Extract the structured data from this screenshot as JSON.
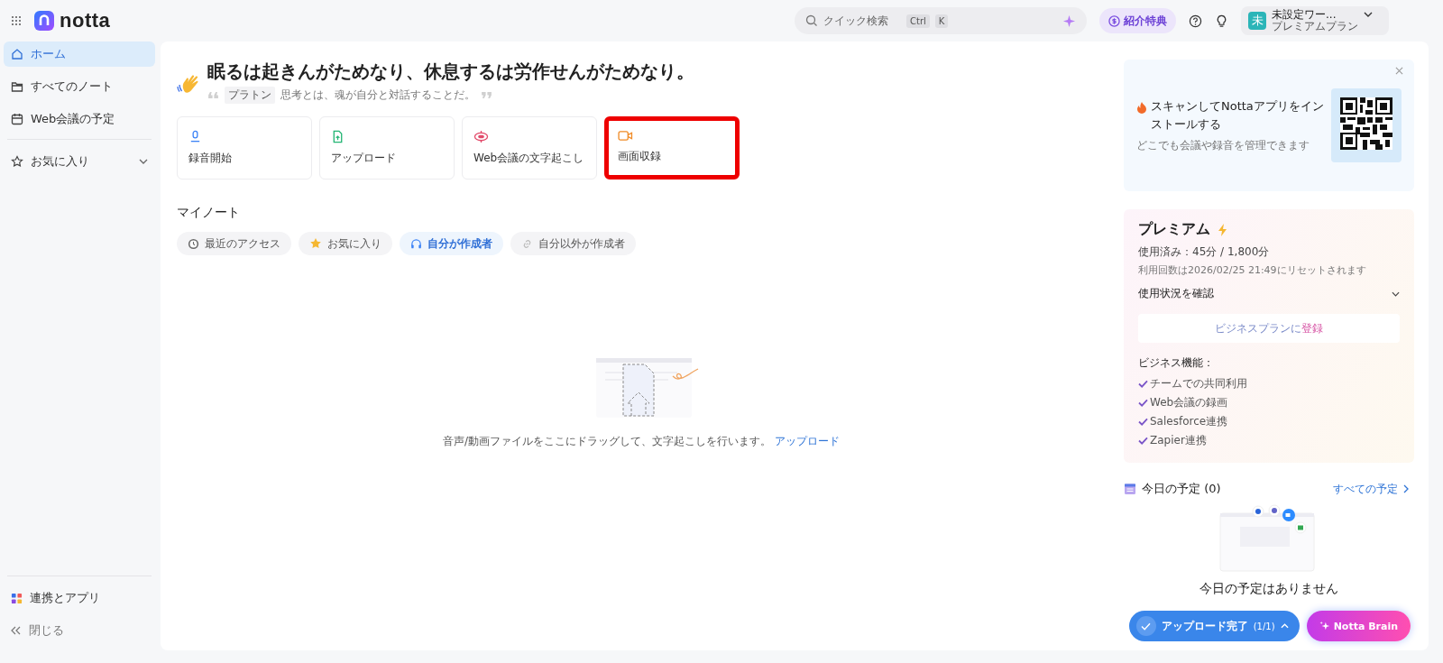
{
  "app": {
    "logo_text": "notta"
  },
  "topbar": {
    "search": {
      "placeholder": "クイック検索",
      "keys": [
        "Ctrl",
        "K"
      ]
    },
    "referral": "紹介特典",
    "account": {
      "avatar_letter": "未",
      "name": "未設定ワー...",
      "plan": "プレミアムプラン"
    }
  },
  "sidebar": {
    "items": [
      {
        "label": "ホーム",
        "selected": true
      },
      {
        "label": "すべてのノート",
        "selected": false
      },
      {
        "label": "Web会議の予定",
        "selected": false
      }
    ],
    "favorites": {
      "label": "お気に入り",
      "expanded": false
    },
    "bottom": [
      {
        "label": "連携とアプリ"
      },
      {
        "label": "閉じる"
      }
    ]
  },
  "greeting": {
    "title": "眠るは起きんがためなり、休息するは労作せんがためなり。",
    "author": "プラトン",
    "quote": "思考とは、魂が自分と対話することだ。"
  },
  "actions": [
    {
      "label": "録音開始",
      "highlighted": false
    },
    {
      "label": "アップロード",
      "highlighted": false
    },
    {
      "label": "Web会議の文字起こし",
      "highlighted": false
    },
    {
      "label": "画面収録",
      "highlighted": true
    }
  ],
  "my_notes": {
    "title": "マイノート",
    "filters": [
      {
        "label": "最近のアクセス",
        "selected": false
      },
      {
        "label": "お気に入り",
        "selected": false
      },
      {
        "label": "自分が作成者",
        "selected": true
      },
      {
        "label": "自分以外が作成者",
        "selected": false
      }
    ],
    "empty_text": "音声/動画ファイルをここにドラッグして、文字起こしを行います。",
    "empty_link": "アップロード"
  },
  "app_promo": {
    "title": "スキャンしてNottaアプリをインストールする",
    "subtitle": "どこでも会議や録音を管理できます"
  },
  "premium": {
    "title": "プレミアム",
    "usage": "使用済み：45分 / 1,800分",
    "reset": "利用回数は2026/02/25 21:49にリセットされます",
    "usage_toggle": {
      "label": "使用状況を確認",
      "expanded": false
    },
    "upgrade_plain": "ビジネスプランに",
    "upgrade_accent": "登録",
    "features_title": "ビジネス機能：",
    "features": [
      "チームでの共同利用",
      "Web会議の録画",
      "Salesforce連携",
      "Zapier連携"
    ]
  },
  "today": {
    "title": "今日の予定 (0)",
    "all_link": "すべての予定",
    "empty_text": "今日の予定はありません"
  },
  "floating": {
    "upload_status": "アップロード完了",
    "upload_count": "(1/1)",
    "brain": "Notta Brain"
  }
}
